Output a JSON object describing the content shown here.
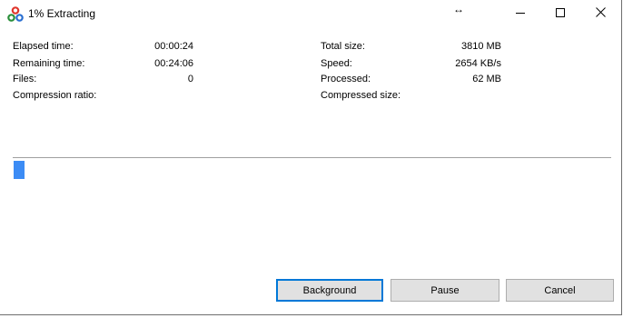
{
  "window": {
    "title": "1% Extracting",
    "resize_glyph": "↔",
    "icons": {
      "app": "7zip-icon",
      "resize": "resize-horizontal-icon",
      "minimize": "minimize-icon",
      "maximize": "maximize-icon",
      "close": "close-icon"
    }
  },
  "stats_left": [
    {
      "label": "Elapsed time:",
      "value": "00:00:24"
    },
    {
      "label": "Remaining time:",
      "value": "00:24:06"
    },
    {
      "label": "Files:",
      "value": "0"
    },
    {
      "label": "Compression ratio:",
      "value": ""
    }
  ],
  "stats_right": [
    {
      "label": "Total size:",
      "value": "3810 MB"
    },
    {
      "label": "Speed:",
      "value": "2654 KB/s"
    },
    {
      "label": "Processed:",
      "value": "62 MB"
    },
    {
      "label": "Compressed size:",
      "value": ""
    }
  ],
  "progress": {
    "fraction": 0.016,
    "color": "#3c8cf5"
  },
  "buttons": {
    "background": "Background",
    "pause": "Pause",
    "cancel": "Cancel"
  }
}
